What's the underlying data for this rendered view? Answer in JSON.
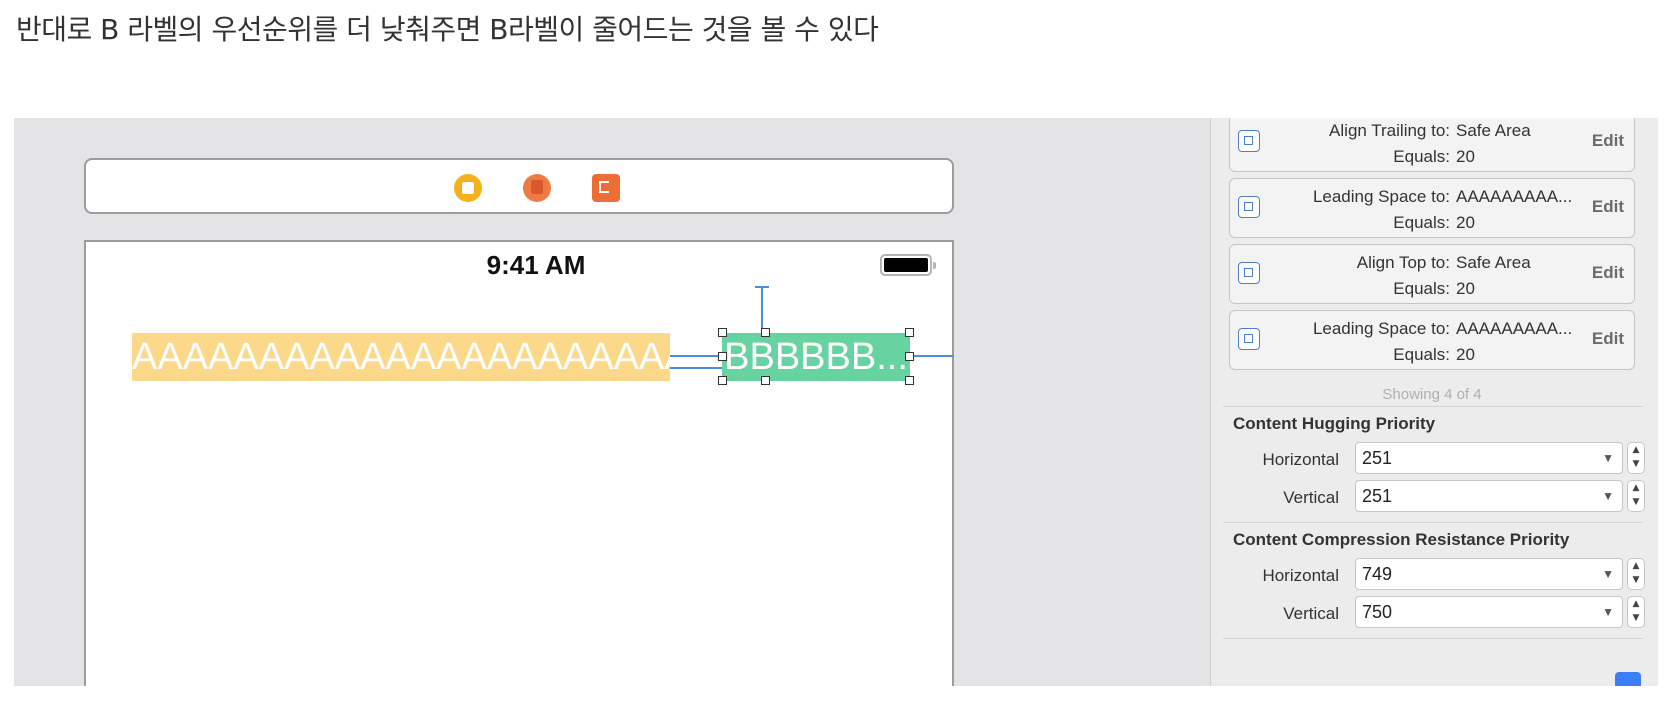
{
  "caption": "반대로 B 라벨의 우선순위를 더 낮춰주면 B라벨이 줄어드는 것을 볼 수 있다",
  "canvas": {
    "status_time": "9:41 AM",
    "label_a_text": "AAAAAAAAAAAAAAAAAAAAAAA",
    "label_b_text": "BBBBBB...",
    "label_a_color": "#fbd88a",
    "label_b_color": "#66d3a0"
  },
  "constraints": [
    {
      "key1": "Align Trailing to:",
      "val1": "Safe Area",
      "key2": "Equals:",
      "val2": "20",
      "edit": "Edit",
      "icon": "align-trailing-icon"
    },
    {
      "key1": "Leading Space to:",
      "val1": "AAAAAAAAA...",
      "key2": "Equals:",
      "val2": "20",
      "edit": "Edit",
      "icon": "leading-space-icon"
    },
    {
      "key1": "Align Top to:",
      "val1": "Safe Area",
      "key2": "Equals:",
      "val2": "20",
      "edit": "Edit",
      "icon": "align-top-icon"
    },
    {
      "key1": "Leading Space to:",
      "val1": "AAAAAAAAA...",
      "key2": "Equals:",
      "val2": "20",
      "edit": "Edit",
      "icon": "leading-space-icon"
    }
  ],
  "showing": "Showing 4 of 4",
  "hugging": {
    "title": "Content Hugging Priority",
    "horizontal_label": "Horizontal",
    "horizontal_value": "251",
    "vertical_label": "Vertical",
    "vertical_value": "251"
  },
  "compression": {
    "title": "Content Compression Resistance Priority",
    "horizontal_label": "Horizontal",
    "horizontal_value": "749",
    "vertical_label": "Vertical",
    "vertical_value": "750"
  }
}
